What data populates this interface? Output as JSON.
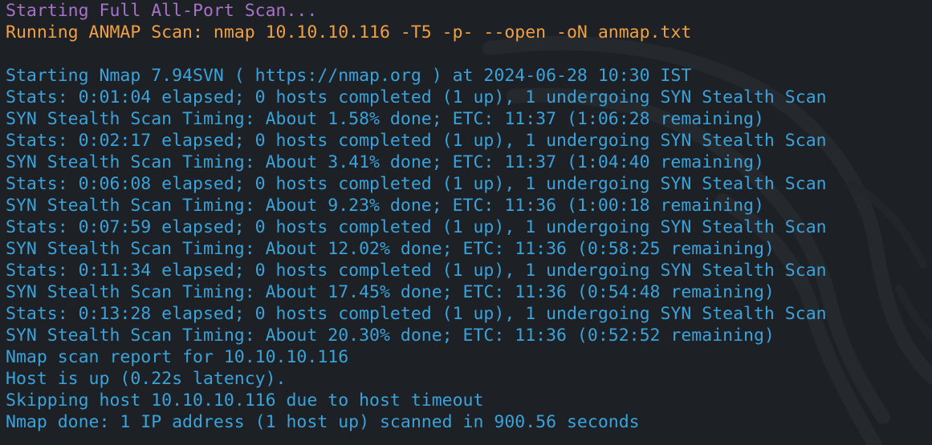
{
  "colors": {
    "background": "#1d2024",
    "purple": "#a673c8",
    "orange": "#f0a044",
    "blue": "#3aa3dc"
  },
  "terminal": {
    "header_line": "Starting Full All-Port Scan...",
    "command_line": "Running ANMAP Scan: nmap 10.10.10.116 -T5 -p- --open -oN anmap.txt",
    "output": [
      "Starting Nmap 7.94SVN ( https://nmap.org ) at 2024-06-28 10:30 IST",
      "Stats: 0:01:04 elapsed; 0 hosts completed (1 up), 1 undergoing SYN Stealth Scan",
      "SYN Stealth Scan Timing: About 1.58% done; ETC: 11:37 (1:06:28 remaining)",
      "Stats: 0:02:17 elapsed; 0 hosts completed (1 up), 1 undergoing SYN Stealth Scan",
      "SYN Stealth Scan Timing: About 3.41% done; ETC: 11:37 (1:04:40 remaining)",
      "Stats: 0:06:08 elapsed; 0 hosts completed (1 up), 1 undergoing SYN Stealth Scan",
      "SYN Stealth Scan Timing: About 9.23% done; ETC: 11:36 (1:00:18 remaining)",
      "Stats: 0:07:59 elapsed; 0 hosts completed (1 up), 1 undergoing SYN Stealth Scan",
      "SYN Stealth Scan Timing: About 12.02% done; ETC: 11:36 (0:58:25 remaining)",
      "Stats: 0:11:34 elapsed; 0 hosts completed (1 up), 1 undergoing SYN Stealth Scan",
      "SYN Stealth Scan Timing: About 17.45% done; ETC: 11:36 (0:54:48 remaining)",
      "Stats: 0:13:28 elapsed; 0 hosts completed (1 up), 1 undergoing SYN Stealth Scan",
      "SYN Stealth Scan Timing: About 20.30% done; ETC: 11:36 (0:52:52 remaining)",
      "Nmap scan report for 10.10.10.116",
      "Host is up (0.22s latency).",
      "Skipping host 10.10.10.116 due to host timeout",
      "Nmap done: 1 IP address (1 host up) scanned in 900.56 seconds"
    ]
  }
}
